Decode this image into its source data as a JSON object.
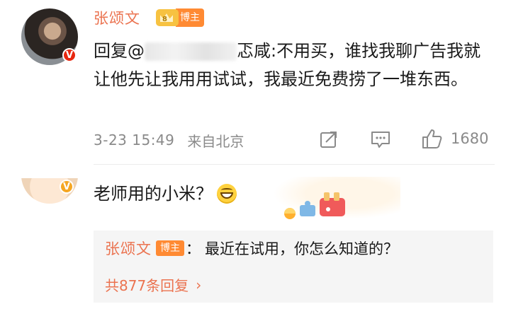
{
  "comment": {
    "author": "张颂文",
    "crown_level": "8",
    "author_badge": "博主",
    "reply_prefix": "回复@",
    "mention_tail": "忑咸",
    "text": ":不用买，谁找我聊广告我就让他先让我用用试试，我最近免费捞了一堆东西。",
    "time": "3-23 15:49",
    "source": "来自北京",
    "likes": "1680"
  },
  "reply": {
    "text": "老师用的小米？",
    "sub_reply": {
      "author": "张颂文",
      "badge": "博主",
      "colon": "：",
      "text": "最近在试用，你怎么知道的？"
    },
    "more_replies": "共877条回复"
  },
  "colors": {
    "author_name": "#eb7350",
    "badge_bg": "#ff8a33",
    "verified_red": "#e8270f",
    "verified_gold": "#f5a623",
    "meta_gray": "#8a8a8a",
    "sub_reply_bg": "#f5f5f5"
  },
  "icons": [
    "verified-badge-icon",
    "crown-icon",
    "share-icon",
    "comment-icon",
    "like-icon",
    "grin-emoji-icon",
    "chevron-right-icon"
  ]
}
